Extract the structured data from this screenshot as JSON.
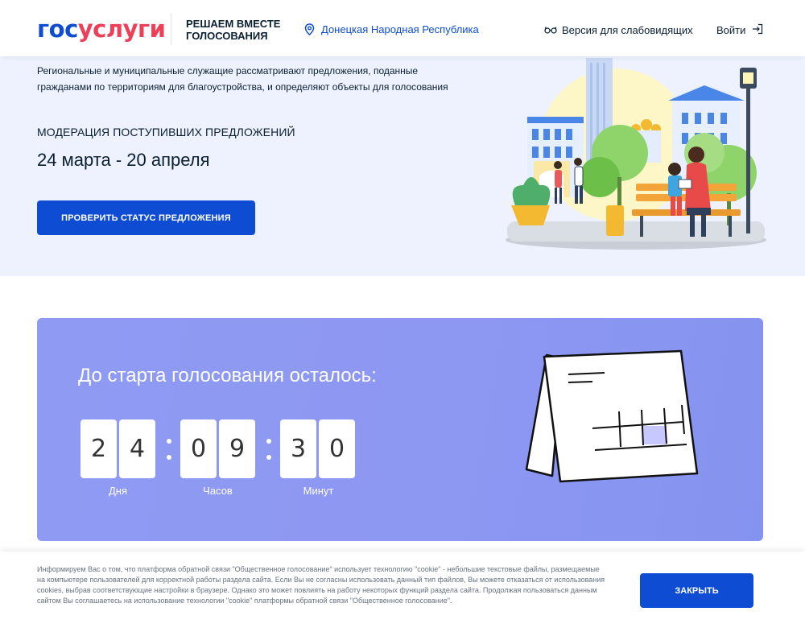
{
  "header": {
    "logo_part1": "гос",
    "logo_part2": "услуги",
    "tagline": "РЕШАЕМ ВМЕСТЕ ГОЛОСОВАНИЯ",
    "region": "Донецкая Народная Республика",
    "vision_label": "Версия для слабовидящих",
    "login_label": "Войти"
  },
  "hero": {
    "description": "Региональные и муниципальные служащие рассматривают предложения, поданные гражданами по территориям для благоустройства, и определяют объекты для голосования",
    "stage": "МОДЕРАЦИЯ ПОСТУПИВШИХ ПРЕДЛОЖЕНИЙ",
    "dates": "24 марта - 20 апреля",
    "button_label": "ПРОВЕРИТЬ СТАТУС ПРЕДЛОЖЕНИЯ"
  },
  "countdown": {
    "title": "До старта голосования осталось:",
    "days_digits": [
      "2",
      "4"
    ],
    "hours_digits": [
      "0",
      "9"
    ],
    "minutes_digits": [
      "3",
      "0"
    ],
    "days_label": "Дня",
    "hours_label": "Часов",
    "minutes_label": "Минут"
  },
  "cookie": {
    "text": "Информируем Вас о том, что платформа обратной связи \"Общественное голосование\" использует технологию \"cookie\" - небольшие текстовые файлы, размещаемые на компьютере пользователей для корректной работы раздела сайта. Если Вы не согласны использовать данный тип файлов, Вы можете отказаться от использования cookies, выбрав соответствующие настройки в браузере. Однако это может повлиять на работу некоторых функций раздела сайта. Продолжая пользоваться данным сайтом Вы соглашаетесь на использование технологии \"cookie\" платформы обратной связи \"Общественное голосование\".",
    "close_label": "ЗАКРЫТЬ"
  },
  "colors": {
    "brand_blue": "#0d4cd3",
    "brand_red": "#ee3f58",
    "hero_bg": "#edf2fe",
    "countdown_bg": "#8d98f2"
  }
}
